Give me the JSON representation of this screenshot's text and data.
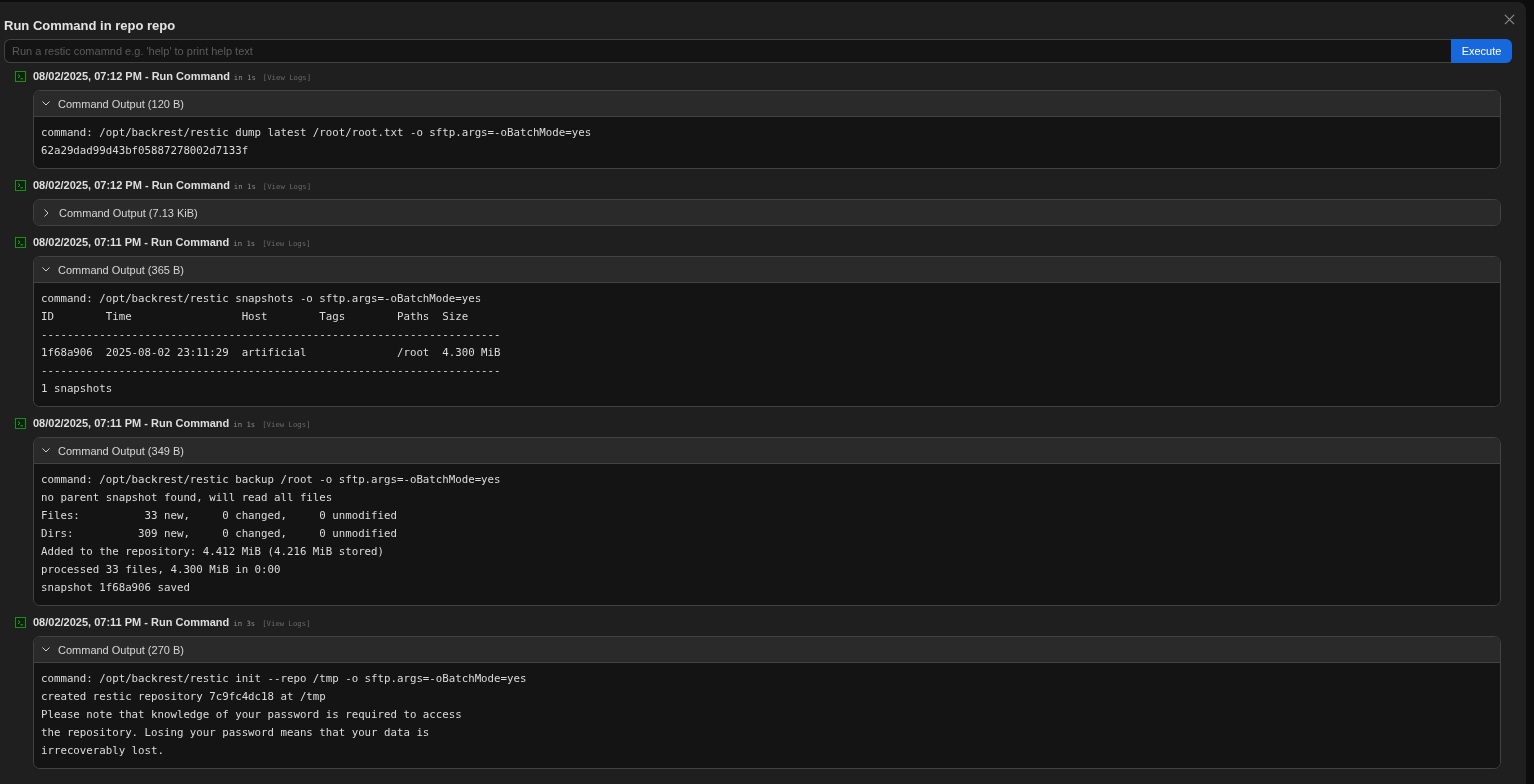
{
  "modal": {
    "title": "Run Command in repo repo"
  },
  "command_field": {
    "placeholder": "Run a restic comamnd e.g. 'help' to print help text"
  },
  "execute_button": "Execute",
  "operations": [
    {
      "title": "08/02/2025, 07:12 PM - Run Command",
      "duration": "in 1s",
      "logs_link": "[View Logs]",
      "output": {
        "label": "Command Output (120 B)",
        "expanded": true,
        "lines": [
          "command: /opt/backrest/restic dump latest /root/root.txt -o sftp.args=-oBatchMode=yes",
          "62a29dad99d43bf05887278002d7133f"
        ]
      }
    },
    {
      "title": "08/02/2025, 07:12 PM - Run Command",
      "duration": "in 1s",
      "logs_link": "[View Logs]",
      "output": {
        "label": "Command Output (7.13 KiB)",
        "expanded": false
      }
    },
    {
      "title": "08/02/2025, 07:11 PM - Run Command",
      "duration": "in 1s",
      "logs_link": "[View Logs]",
      "output": {
        "label": "Command Output (365 B)",
        "expanded": true,
        "lines": [
          "command: /opt/backrest/restic snapshots -o sftp.args=-oBatchMode=yes",
          "ID        Time                 Host        Tags        Paths  Size",
          "-----------------------------------------------------------------------",
          "1f68a906  2025-08-02 23:11:29  artificial              /root  4.300 MiB",
          "-----------------------------------------------------------------------",
          "1 snapshots"
        ]
      }
    },
    {
      "title": "08/02/2025, 07:11 PM - Run Command",
      "duration": "in 1s",
      "logs_link": "[View Logs]",
      "output": {
        "label": "Command Output (349 B)",
        "expanded": true,
        "lines": [
          "command: /opt/backrest/restic backup /root -o sftp.args=-oBatchMode=yes",
          "no parent snapshot found, will read all files",
          "Files:          33 new,     0 changed,     0 unmodified",
          "Dirs:          309 new,     0 changed,     0 unmodified",
          "Added to the repository: 4.412 MiB (4.216 MiB stored)",
          "processed 33 files, 4.300 MiB in 0:00",
          "snapshot 1f68a906 saved"
        ]
      }
    },
    {
      "title": "08/02/2025, 07:11 PM - Run Command",
      "duration": "in 3s",
      "logs_link": "[View Logs]",
      "output": {
        "label": "Command Output (270 B)",
        "expanded": true,
        "lines": [
          "command: /opt/backrest/restic init --repo /tmp -o sftp.args=-oBatchMode=yes",
          "created restic repository 7c9fc4dc18 at /tmp",
          "Please note that knowledge of your password is required to access",
          "the repository. Losing your password means that your data is",
          "irrecoverably lost."
        ]
      }
    }
  ]
}
